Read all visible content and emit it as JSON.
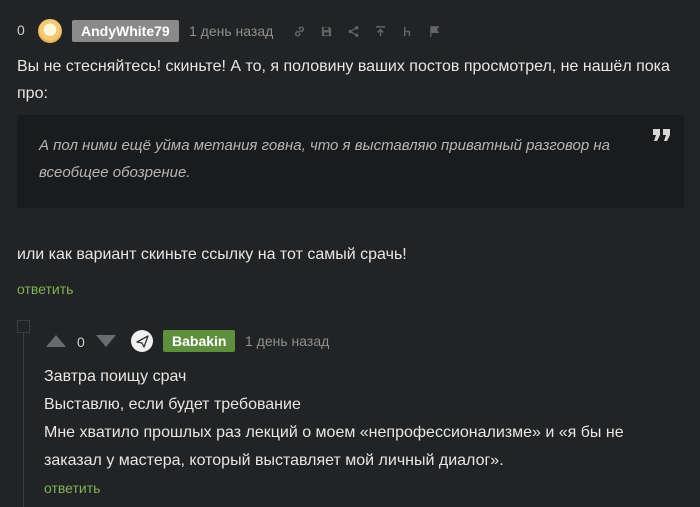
{
  "comment1": {
    "rating": "0",
    "username": "AndyWhite79",
    "time": "1 день назад",
    "text": "Вы не стесняйтесь! скиньте! А то, я половину ваших постов просмотрел, не нашёл пока про:",
    "quote": "А пол ними ещё уйма метания говна, что я выставляю приватный разговор на всеобщее обозрение.",
    "text_after": "или как вариант скиньте ссылку на тот самый срачь!",
    "reply_label": "ответить"
  },
  "comment2": {
    "rating": "0",
    "username": "Babakin",
    "time": "1 день назад",
    "lines": [
      "Завтра поищу срач",
      "Выставлю, если будет требование",
      "Мне хватило прошлых раз лекций о моем «непрофессионализме» и «я бы не заказал у мастера, который выставляет мой личный диалог»."
    ],
    "reply_label": "ответить"
  },
  "icons": [
    "link-icon",
    "save-icon",
    "share-icon",
    "go-to-parent-icon",
    "branch-icon",
    "flag-icon",
    "quote-icon",
    "upvote-icon",
    "downvote-icon",
    "collapse-icon"
  ],
  "colors": {
    "background": "#222324",
    "quote_bg": "#1a1b1c",
    "reply": "#7eb256",
    "nick1_bg": "#8a8a8a",
    "nick2_bg": "#5f8f3e"
  }
}
